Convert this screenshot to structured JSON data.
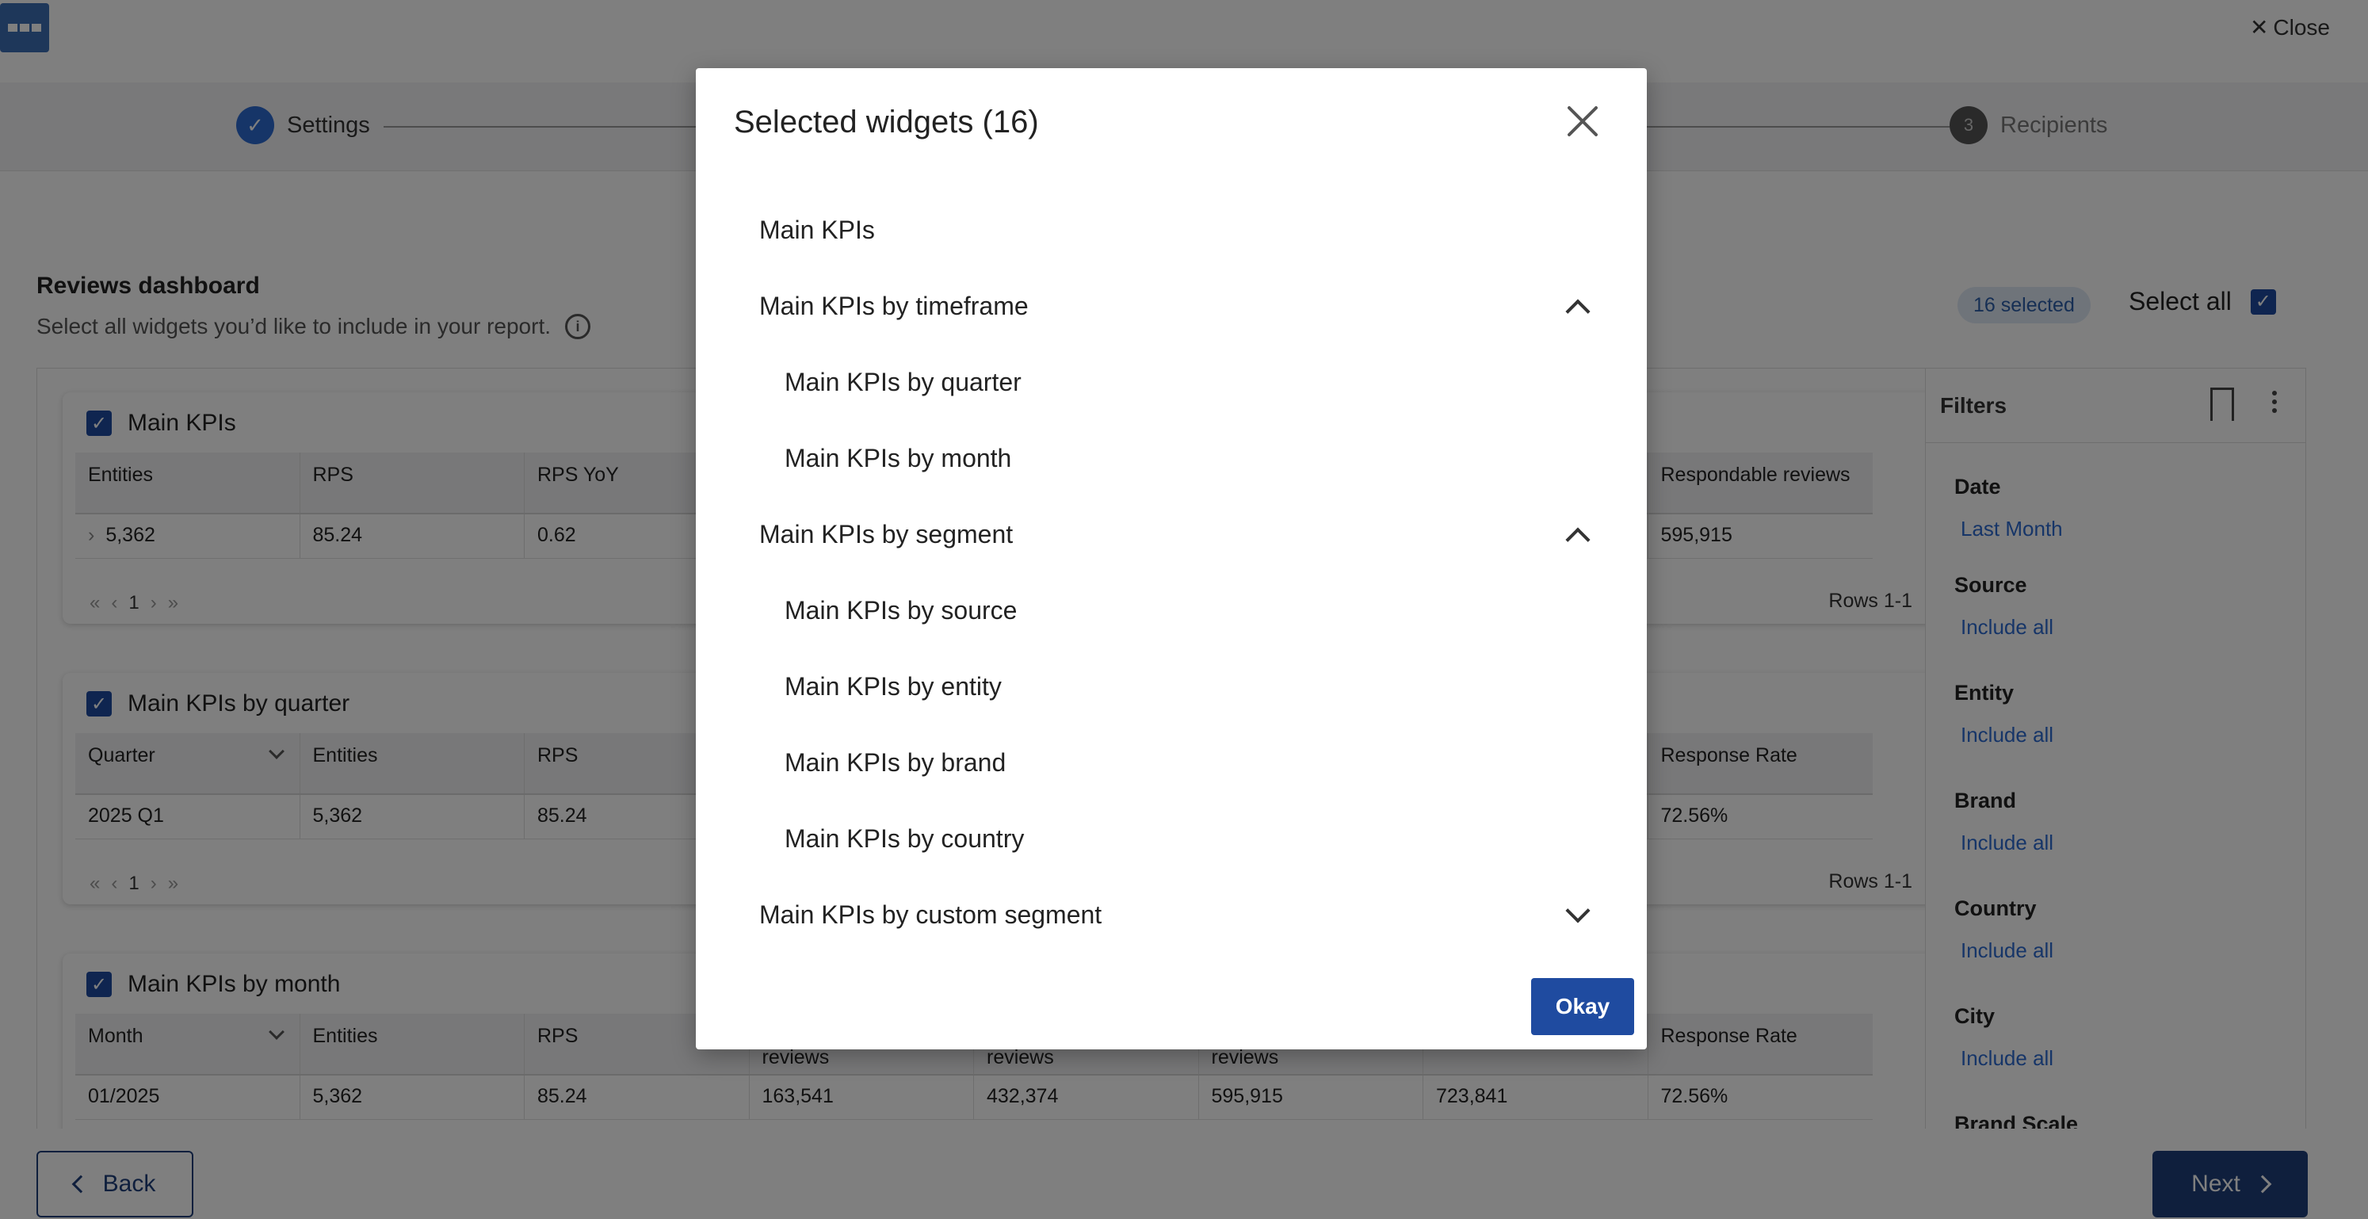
{
  "topbar": {
    "close_label": "Close"
  },
  "stepper": {
    "step1": "Settings",
    "step3_number": "3",
    "step3": "Recipients"
  },
  "dashboard": {
    "title": "Reviews dashboard",
    "subtitle": "Select all widgets you’d like to include in your report.",
    "selected_badge": "16 selected",
    "select_all_label": "Select all"
  },
  "widgets": [
    {
      "title": "Main KPIs",
      "headers": [
        "Entities",
        "RPS",
        "RPS YoY",
        "",
        "",
        "",
        "",
        "Respondable reviews"
      ],
      "row": [
        "5,362",
        "85.24",
        "0.62",
        "",
        "",
        "",
        "",
        "595,915"
      ],
      "page": "1",
      "rows_info": "Rows 1-1"
    },
    {
      "title": "Main KPIs by quarter",
      "headers": [
        "Quarter",
        "Entities",
        "RPS",
        "",
        "",
        "",
        "",
        "Response Rate"
      ],
      "row": [
        "2025 Q1",
        "5,362",
        "85.24",
        "",
        "",
        "",
        "",
        "72.56%"
      ],
      "page": "1",
      "rows_info": "Rows 1-1"
    },
    {
      "title": "Main KPIs by month",
      "headers": [
        "Month",
        "Entities",
        "RPS",
        "reviews",
        "reviews",
        "reviews",
        "",
        "Response Rate"
      ],
      "row": [
        "01/2025",
        "5,362",
        "85.24",
        "163,541",
        "432,374",
        "595,915",
        "723,841",
        "72.56%"
      ]
    }
  ],
  "filters": {
    "title": "Filters",
    "items": [
      {
        "label": "Date",
        "value": "Last Month"
      },
      {
        "label": "Source",
        "value": "Include all"
      },
      {
        "label": "Entity",
        "value": "Include all"
      },
      {
        "label": "Brand",
        "value": "Include all"
      },
      {
        "label": "Country",
        "value": "Include all"
      },
      {
        "label": "City",
        "value": "Include all"
      },
      {
        "label": "Brand Scale",
        "value": ""
      }
    ]
  },
  "footer": {
    "back_label": "Back",
    "next_label": "Next"
  },
  "modal": {
    "title": "Selected widgets (16)",
    "items": [
      "Main KPIs",
      "Main KPIs by timeframe",
      "Main KPIs by quarter",
      "Main KPIs by month",
      "Main KPIs by segment",
      "Main KPIs by source",
      "Main KPIs by entity",
      "Main KPIs by brand",
      "Main KPIs by country",
      "Main KPIs by custom segment"
    ],
    "okay_label": "Okay"
  }
}
